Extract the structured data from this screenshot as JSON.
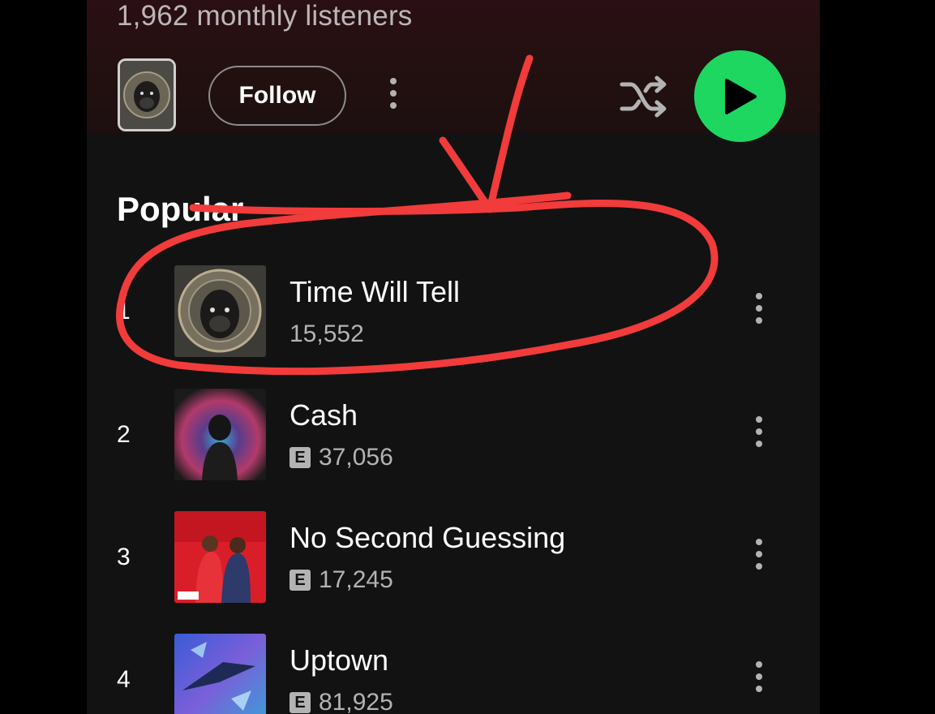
{
  "artist": {
    "monthly_listeners": "1,962 monthly listeners",
    "follow_label": "Follow"
  },
  "popular": {
    "title": "Popular",
    "tracks": [
      {
        "rank": "1",
        "title": "Time Will Tell",
        "plays": "15,552",
        "explicit": false
      },
      {
        "rank": "2",
        "title": "Cash",
        "plays": "37,056",
        "explicit": true
      },
      {
        "rank": "3",
        "title": "No Second Guessing",
        "plays": "17,245",
        "explicit": true
      },
      {
        "rank": "4",
        "title": "Uptown",
        "plays": "81,925",
        "explicit": true
      }
    ]
  },
  "explicit_badge": "E",
  "colors": {
    "play_green": "#1ed760",
    "annotation_red": "#f23b3b",
    "background": "#121212"
  },
  "icons": [
    "more-vert-icon",
    "shuffle-icon",
    "play-icon"
  ]
}
